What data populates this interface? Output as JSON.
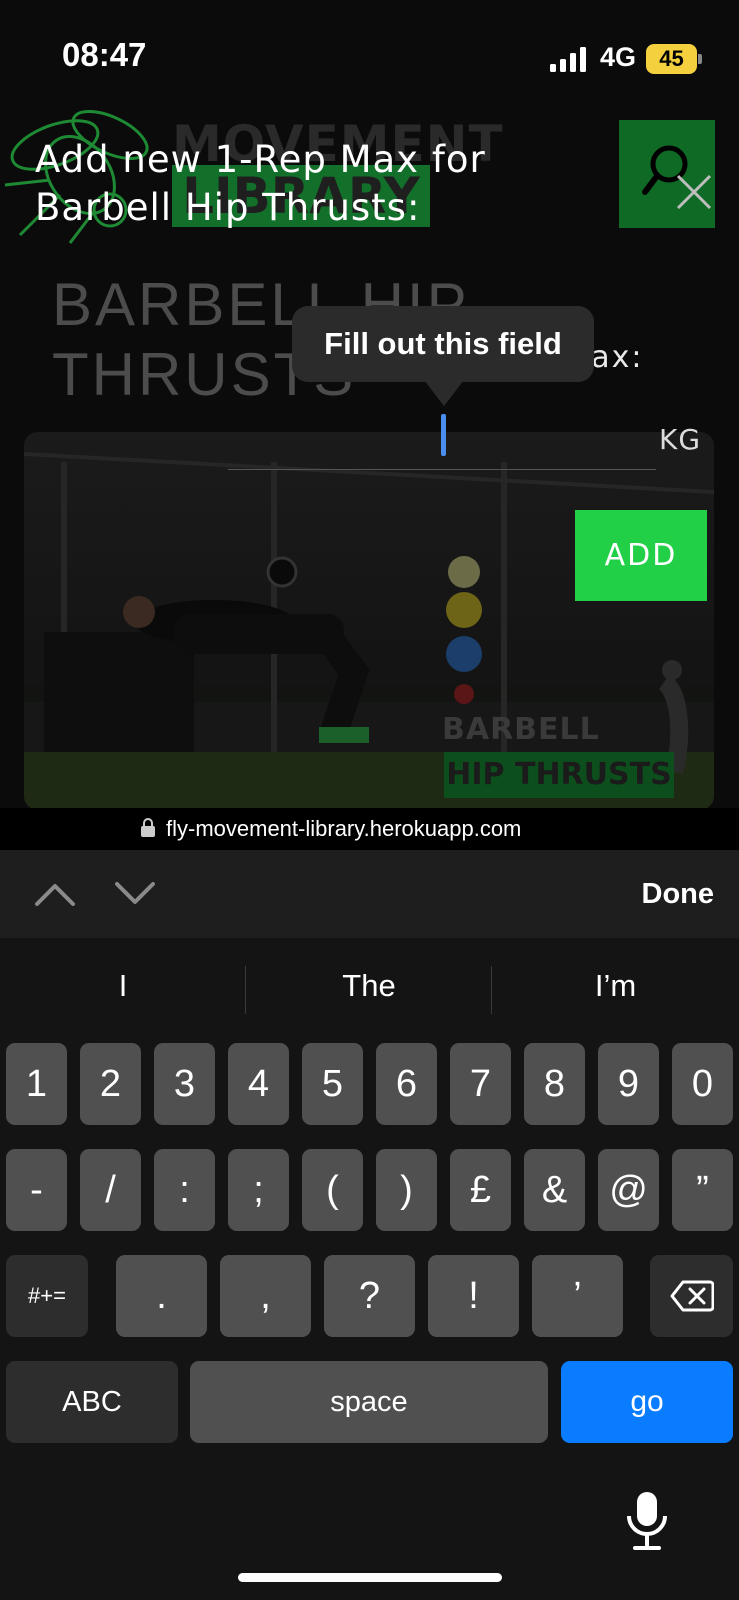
{
  "status_bar": {
    "time": "08:47",
    "network": "4G",
    "battery": "45",
    "battery_color": "#f4d03f"
  },
  "page": {
    "logo_text_top": "MOVEMENT",
    "logo_text_bottom": "LIBRARY",
    "title_line_1": "BARBELL HIP",
    "title_line_2": "THRUSTS",
    "video_caption_1": "BARBELL",
    "video_caption_2": "HIP THRUSTS",
    "search_icon": "search-icon"
  },
  "modal": {
    "title": "Add new 1-Rep Max for Barbell Hip Thrusts:",
    "input_label": "max:",
    "input_value": "",
    "unit": "KG",
    "add_label": "ADD",
    "accent_color": "#22d048",
    "close_icon": "close-icon"
  },
  "tooltip": {
    "text": "Fill out this field"
  },
  "url_bar": {
    "url": "fly-movement-library.herokuapp.com",
    "icon": "lock-icon"
  },
  "accessory_bar": {
    "prev_icon": "chevron-up-icon",
    "next_icon": "chevron-down-icon",
    "done_label": "Done"
  },
  "keyboard": {
    "suggestions": [
      "I",
      "The",
      "I’m"
    ],
    "row1": [
      "1",
      "2",
      "3",
      "4",
      "5",
      "6",
      "7",
      "8",
      "9",
      "0"
    ],
    "row2": [
      "-",
      "/",
      ":",
      ";",
      "(",
      ")",
      "£",
      "&",
      "@",
      "”"
    ],
    "row3": [
      "#+=",
      ".",
      ",",
      "?",
      "!",
      "’"
    ],
    "row4": [
      "ABC",
      "space",
      "go"
    ],
    "delete_icon": "backspace-icon",
    "mic_icon": "microphone-icon",
    "go_color": "#0a7cff"
  }
}
